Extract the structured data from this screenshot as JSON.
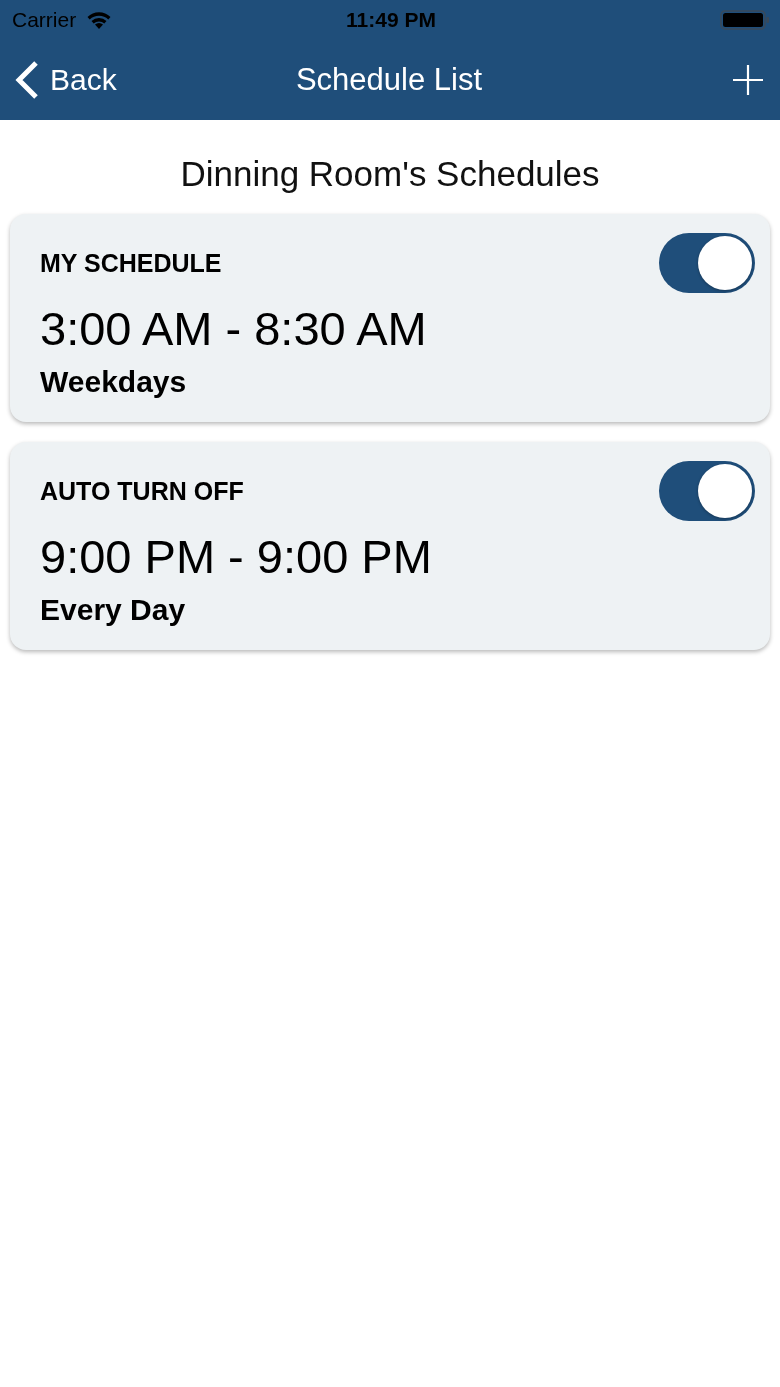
{
  "status_bar": {
    "carrier": "Carrier",
    "time": "11:49 PM"
  },
  "nav_bar": {
    "back_label": "Back",
    "title": "Schedule List"
  },
  "heading": "Dinning Room's Schedules",
  "schedules": [
    {
      "name": "MY SCHEDULE",
      "time_range": "3:00 AM - 8:30 AM",
      "days": "Weekdays",
      "on": true
    },
    {
      "name": "AUTO TURN OFF",
      "time_range": "9:00 PM - 9:00 PM",
      "days": "Every Day",
      "on": true
    }
  ]
}
